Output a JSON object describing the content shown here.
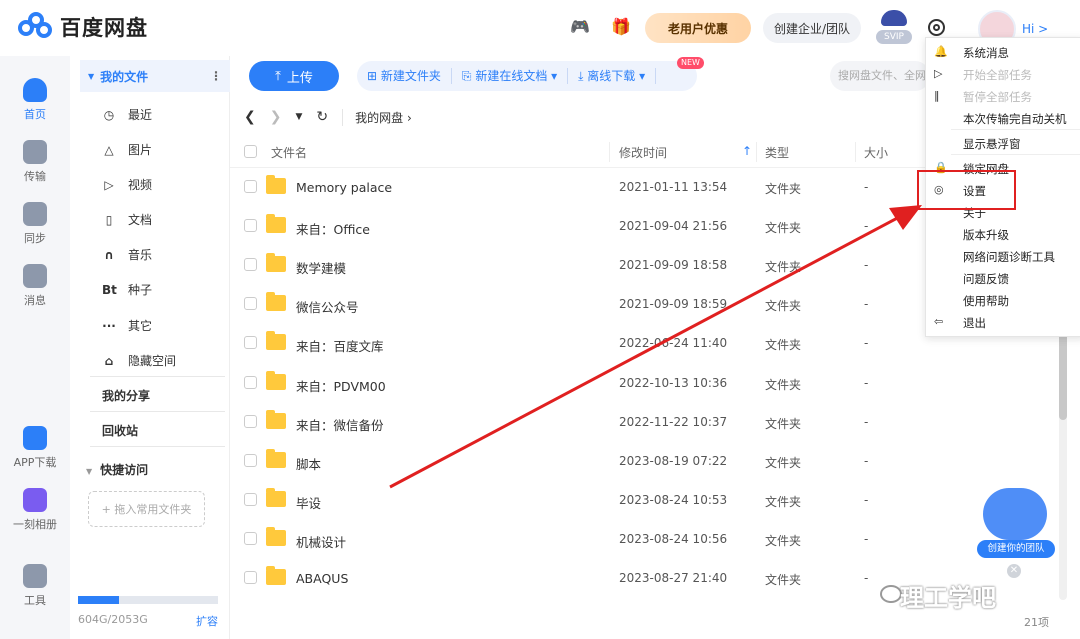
{
  "app": {
    "title": "百度网盘",
    "hi": "Hi >"
  },
  "topbar": {
    "promo": "老用户优惠",
    "team": "创建企业/团队",
    "svip": "SVIP",
    "icons": [
      "gamepad-icon",
      "gift-icon",
      "settings-icon",
      "avatar"
    ]
  },
  "leftnav": [
    "首页",
    "传输",
    "同步",
    "消息",
    "APP下载",
    "一刻相册",
    "工具"
  ],
  "sidebar": {
    "my_files": "我的文件",
    "items": [
      {
        "icon": "◷",
        "label": "最近"
      },
      {
        "icon": "△",
        "label": "图片"
      },
      {
        "icon": "▷",
        "label": "视频"
      },
      {
        "icon": "▯",
        "label": "文档"
      },
      {
        "icon": "∩",
        "label": "音乐"
      },
      {
        "icon": "Bt",
        "label": "种子"
      },
      {
        "icon": "···",
        "label": "其它"
      },
      {
        "icon": "⌂",
        "label": "隐藏空间"
      }
    ],
    "my_share": "我的分享",
    "recycle": "回收站",
    "quick_access": "快捷访问",
    "drop_hint": "+ 拖入常用文件夹",
    "storage": "604G/2053G",
    "storage_ratio": 0.294,
    "expand": "扩容"
  },
  "toolbar": {
    "upload": "上传",
    "new_folder": "新建文件夹",
    "new_online_doc": "新建在线文档",
    "new_badge": "NEW",
    "offline_download": "离线下载",
    "search_placeholder": "搜网盘文件、全网"
  },
  "path": {
    "crumb": "我的网盘"
  },
  "table": {
    "headers": {
      "name": "文件名",
      "time": "修改时间",
      "type": "类型",
      "size": "大小"
    },
    "rows": [
      {
        "name": "Memory palace",
        "time": "2021-01-11 13:54",
        "type": "文件夹",
        "size": "-"
      },
      {
        "name": "来自：Office",
        "time": "2021-09-04 21:56",
        "type": "文件夹",
        "size": "-"
      },
      {
        "name": "数学建模",
        "time": "2021-09-09 18:58",
        "type": "文件夹",
        "size": "-"
      },
      {
        "name": "微信公众号",
        "time": "2021-09-09 18:59",
        "type": "文件夹",
        "size": "-"
      },
      {
        "name": "来自：百度文库",
        "time": "2022-06-24 11:40",
        "type": "文件夹",
        "size": "-"
      },
      {
        "name": "来自：PDVM00",
        "time": "2022-10-13 10:36",
        "type": "文件夹",
        "size": "-"
      },
      {
        "name": "来自：微信备份",
        "time": "2022-11-22 10:37",
        "type": "文件夹",
        "size": "-"
      },
      {
        "name": "脚本",
        "time": "2023-08-19 07:22",
        "type": "文件夹",
        "size": "-"
      },
      {
        "name": "毕设",
        "time": "2023-08-24 10:53",
        "type": "文件夹",
        "size": "-"
      },
      {
        "name": "机械设计",
        "time": "2023-08-24 10:56",
        "type": "文件夹",
        "size": "-"
      },
      {
        "name": "ABAQUS",
        "time": "2023-08-27 21:40",
        "type": "文件夹",
        "size": "-"
      }
    ],
    "count": "21项"
  },
  "menu": {
    "items": [
      {
        "label": "系统消息",
        "icon": "bell-icon",
        "disabled": false
      },
      {
        "label": "开始全部任务",
        "icon": "play-icon",
        "disabled": true
      },
      {
        "label": "暂停全部任务",
        "icon": "pause-icon",
        "disabled": true
      },
      {
        "label": "本次传输完自动关机",
        "icon": "",
        "disabled": false
      },
      {
        "label": "显示悬浮窗",
        "icon": "",
        "disabled": false
      },
      {
        "label": "锁定网盘",
        "icon": "lock-icon",
        "disabled": false
      },
      {
        "label": "设置",
        "icon": "settings-icon",
        "disabled": false
      },
      {
        "label": "关于",
        "icon": "",
        "disabled": false
      },
      {
        "label": "版本升级",
        "icon": "",
        "disabled": false
      },
      {
        "label": "网络问题诊断工具",
        "icon": "",
        "disabled": false
      },
      {
        "label": "问题反馈",
        "icon": "",
        "disabled": false
      },
      {
        "label": "使用帮助",
        "icon": "",
        "disabled": false
      },
      {
        "label": "退出",
        "icon": "logout-icon",
        "disabled": false
      }
    ]
  },
  "widget": {
    "label": "创建你的团队"
  },
  "watermark": "理工学吧",
  "colors": {
    "accent": "#2c7ff8",
    "folder": "#ffc93c",
    "highlight": "#e02020"
  }
}
